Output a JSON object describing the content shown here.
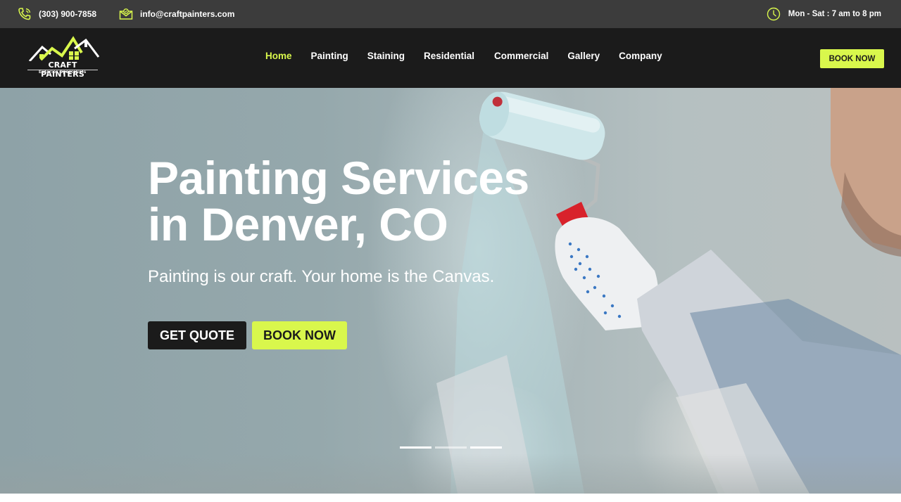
{
  "topbar": {
    "phone": "(303) 900-7858",
    "email": "info@craftpainters.com",
    "hours": "Mon - Sat : 7 am to 8 pm",
    "phone_icon": "phone-icon",
    "email_icon": "envelope-icon",
    "hours_icon": "clock-icon"
  },
  "brand": {
    "name": "CRAFT PAINTERS",
    "tagline": "Exterior Specialists",
    "accent": "#d9f74c",
    "dark": "#1b1b1b"
  },
  "nav": {
    "items": [
      {
        "label": "Home",
        "active": true
      },
      {
        "label": "Painting"
      },
      {
        "label": "Staining"
      },
      {
        "label": "Residential"
      },
      {
        "label": "Commercial"
      },
      {
        "label": "Gallery"
      },
      {
        "label": "Company"
      }
    ],
    "cta": "BOOK NOW"
  },
  "hero": {
    "title_line1": "Painting Services",
    "title_line2": "in Denver, CO",
    "subtitle": "Painting is our craft. Your home is the Canvas.",
    "quote_button": "GET QUOTE",
    "book_button": "BOOK NOW",
    "slides_total": 3,
    "slide_active": 1
  }
}
